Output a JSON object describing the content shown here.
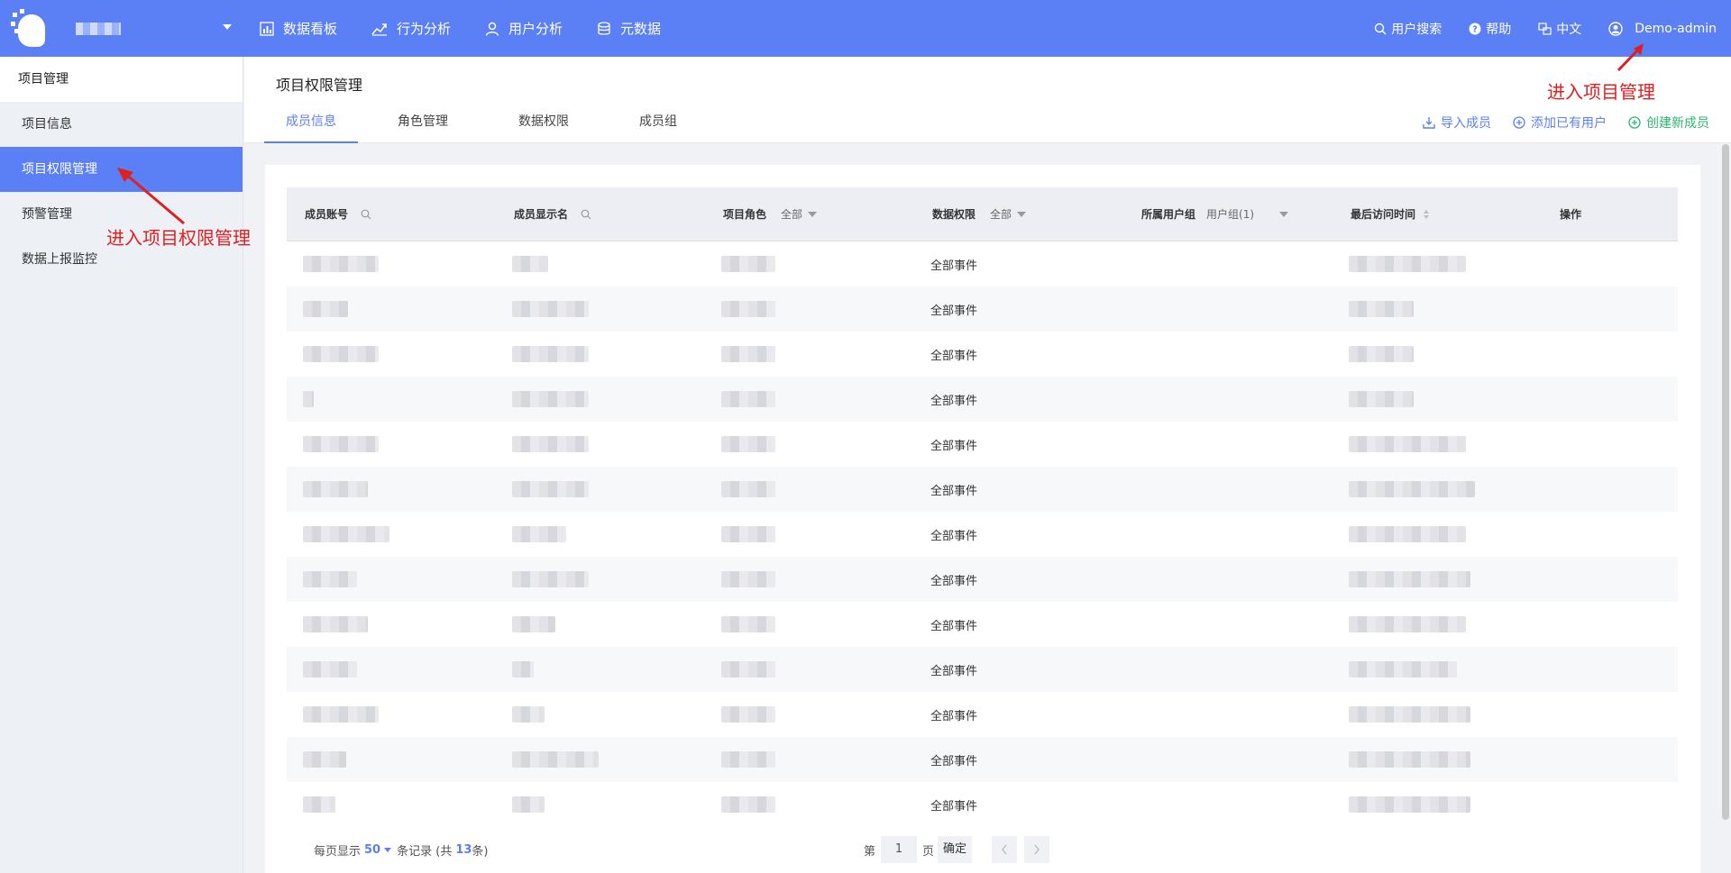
{
  "topbar": {
    "nav": [
      {
        "label": "数据看板"
      },
      {
        "label": "行为分析"
      },
      {
        "label": "用户分析"
      },
      {
        "label": "元数据"
      }
    ],
    "right": {
      "search": "用户搜索",
      "help": "帮助",
      "lang": "中文",
      "user": "Demo-admin"
    }
  },
  "sidebar": {
    "header": "项目管理",
    "items": [
      {
        "label": "项目信息"
      },
      {
        "label": "项目权限管理"
      },
      {
        "label": "预警管理"
      },
      {
        "label": "数据上报监控"
      }
    ]
  },
  "main": {
    "title": "项目权限管理",
    "tabs": [
      {
        "label": "成员信息"
      },
      {
        "label": "角色管理"
      },
      {
        "label": "数据权限"
      },
      {
        "label": "成员组"
      }
    ],
    "actions": {
      "import": "导入成员",
      "add_existing": "添加已有用户",
      "create_new": "创建新成员"
    }
  },
  "table": {
    "headers": {
      "account": "成员账号",
      "display_name": "成员显示名",
      "role": "项目角色",
      "role_filter": "全部",
      "data_perm": "数据权限",
      "data_filter": "全部",
      "user_group": "所属用户组",
      "group_filter": "用户组(1)",
      "last_visit": "最后访问时间",
      "ops": "操作"
    },
    "rows": [
      {
        "data_perm": "全部事件"
      },
      {
        "data_perm": "全部事件"
      },
      {
        "data_perm": "全部事件"
      },
      {
        "data_perm": "全部事件"
      },
      {
        "data_perm": "全部事件"
      },
      {
        "data_perm": "全部事件"
      },
      {
        "data_perm": "全部事件"
      },
      {
        "data_perm": "全部事件"
      },
      {
        "data_perm": "全部事件"
      },
      {
        "data_perm": "全部事件"
      },
      {
        "data_perm": "全部事件"
      },
      {
        "data_perm": "全部事件"
      },
      {
        "data_perm": "全部事件"
      }
    ]
  },
  "pager": {
    "per_page_prefix": "每页显示",
    "per_page": "50",
    "records_prefix": "条记录 (共",
    "total": "13",
    "records_suffix": "条)",
    "page_prefix": "第",
    "page": "1",
    "page_suffix": "页",
    "confirm": "确定"
  },
  "annotations": {
    "enter_project_mgmt": "进入项目管理",
    "enter_perm_mgmt": "进入项目权限管理"
  }
}
